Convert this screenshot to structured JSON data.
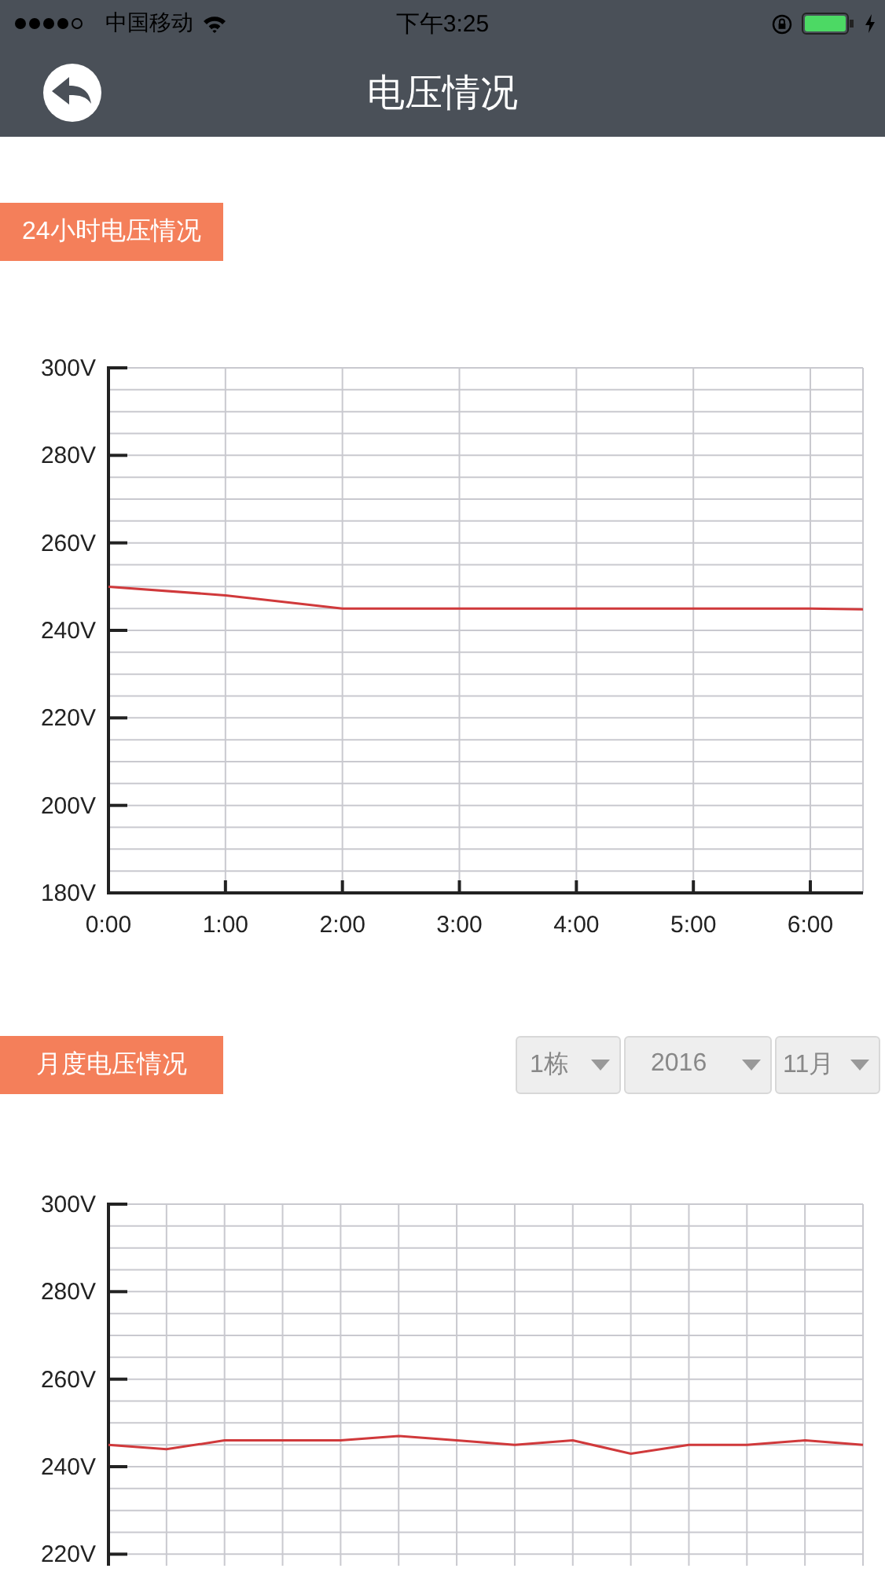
{
  "status_bar": {
    "carrier": "中国移动",
    "time": "下午3:25"
  },
  "nav_bar": {
    "title": "电压情况"
  },
  "sections": [
    {
      "title": "24小时电压情况",
      "chart_data": {
        "type": "line",
        "x": [
          0,
          1,
          2,
          3,
          4,
          5,
          6,
          6.45
        ],
        "series": [
          {
            "color": "#d0393b",
            "values": [
              250,
              248,
              245,
              245,
              245,
              245,
              245,
              244.8
            ]
          }
        ],
        "xlim": [
          0,
          6.45
        ],
        "ylim": [
          180,
          300
        ],
        "grid": true,
        "xticks": [
          {
            "value": 0,
            "label": "0:00"
          },
          {
            "value": 1,
            "label": "1:00"
          },
          {
            "value": 2,
            "label": "2:00"
          },
          {
            "value": 3,
            "label": "3:00"
          },
          {
            "value": 4,
            "label": "4:00"
          },
          {
            "value": 5,
            "label": "5:00"
          },
          {
            "value": 6,
            "label": "6:00"
          }
        ],
        "yticks": [
          {
            "value": 180,
            "label": "180V"
          },
          {
            "value": 200,
            "label": "200V"
          },
          {
            "value": 220,
            "label": "220V"
          },
          {
            "value": 240,
            "label": "240V"
          },
          {
            "value": 260,
            "label": "260V"
          },
          {
            "value": 280,
            "label": "280V"
          },
          {
            "value": 300,
            "label": "300V"
          }
        ]
      }
    },
    {
      "title": "月度电压情况",
      "selects": [
        "1栋",
        "2016",
        "11月"
      ],
      "chart_data": {
        "type": "line",
        "categories": [
          null,
          null,
          null,
          null,
          null,
          null,
          null,
          null,
          null,
          null,
          null,
          null,
          null,
          null
        ],
        "series": [
          {
            "color": "#d0393b",
            "values": [
              245,
              244,
              246,
              246,
              246,
              247,
              246,
              245,
              246,
              243,
              245,
              245,
              246,
              245
            ]
          }
        ],
        "ylim": [
          217.3,
          300
        ],
        "grid": true,
        "yticks": [
          {
            "value": 220,
            "label": "220V"
          },
          {
            "value": 240,
            "label": "240V"
          },
          {
            "value": 260,
            "label": "260V"
          },
          {
            "value": 280,
            "label": "280V"
          },
          {
            "value": 300,
            "label": "300V"
          }
        ]
      }
    }
  ]
}
